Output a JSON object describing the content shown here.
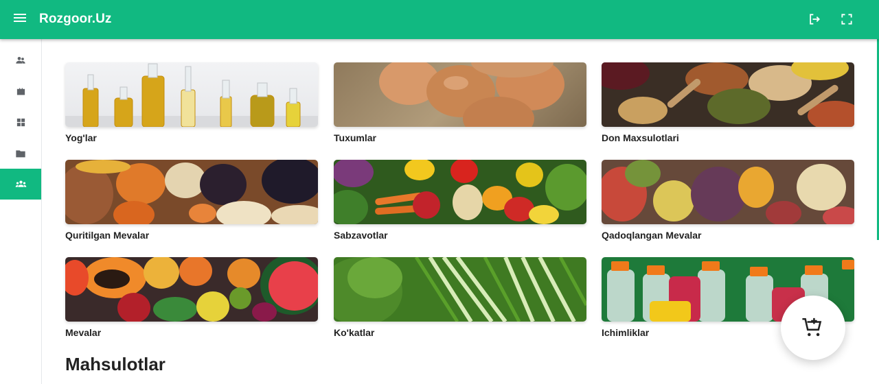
{
  "header": {
    "brand": "Rozgoor.Uz",
    "background": "#11b981"
  },
  "sidebar": {
    "items": [
      {
        "icon": "users-icon"
      },
      {
        "icon": "briefcase-icon"
      },
      {
        "icon": "grid-icon"
      },
      {
        "icon": "folder-icon"
      },
      {
        "icon": "group-icon",
        "active": true
      }
    ]
  },
  "categories": [
    {
      "label": "Yog'lar",
      "image": "oil-bottles"
    },
    {
      "label": "Tuxumlar",
      "image": "eggs"
    },
    {
      "label": "Don Maxsulotlari",
      "image": "grains-spices"
    },
    {
      "label": "Quritilgan Mevalar",
      "image": "dried-fruits-nuts"
    },
    {
      "label": "Sabzavotlar",
      "image": "vegetables"
    },
    {
      "label": "Qadoqlangan Mevalar",
      "image": "packaged-fruits"
    },
    {
      "label": "Mevalar",
      "image": "fruits"
    },
    {
      "label": "Ko'katlar",
      "image": "greens"
    },
    {
      "label": "Ichimliklar",
      "image": "bottled-drinks"
    }
  ],
  "products_section": {
    "title": "Mahsulotlar"
  },
  "cart_fab": {
    "icon": "add-to-cart-icon"
  }
}
